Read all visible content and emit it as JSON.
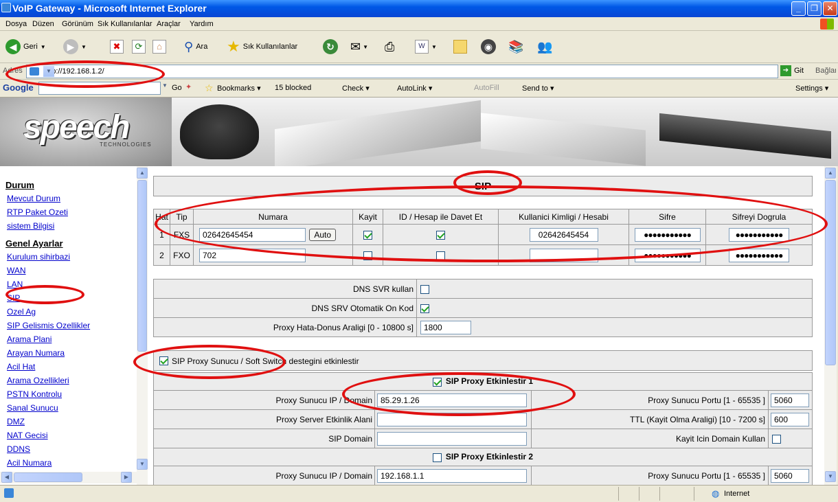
{
  "window": {
    "title": "VoIP Gateway - Microsoft Internet Explorer"
  },
  "menu": [
    "Dosya",
    "Düzen",
    "Görünüm",
    "Sık Kullanılanlar",
    "Araçlar",
    "Yardım"
  ],
  "toolbar": {
    "back": "Geri",
    "search": "Ara",
    "favorites": "Sık Kullanılanlar"
  },
  "address": {
    "label": "Adres",
    "url": "http://192.168.1.2/",
    "go": "Git",
    "links": "Bağlantılar"
  },
  "google": {
    "logo": "Google",
    "go": "Go",
    "bookmarks": "Bookmarks",
    "blocked": "15 blocked",
    "check": "Check",
    "autolink": "AutoLink",
    "autofill": "AutoFill",
    "send": "Send to",
    "settings": "Settings"
  },
  "banner": {
    "logo": "speech",
    "sub": "TECHNOLOGIES"
  },
  "sidebar": {
    "sections": [
      {
        "title": "Durum",
        "items": [
          "Mevcut Durum",
          "RTP Paket Ozeti",
          "sistem Bilgisi"
        ]
      },
      {
        "title": "Genel Ayarlar",
        "items": [
          "Kurulum sihirbazi",
          "WAN",
          "LAN",
          "SIP",
          "Ozel Ag",
          "SIP Gelismis Ozellikler",
          "Arama Plani",
          "Arayan Numara",
          "Acil Hat",
          "Arama Ozellikleri",
          "PSTN Kontrolu",
          "Sanal Sunucu",
          "DMZ",
          "NAT Gecisi",
          "DDNS",
          "Acil Numara"
        ]
      }
    ]
  },
  "sip": {
    "title": "SIP",
    "headers": [
      "Hat",
      "Tip",
      "Numara",
      "Kayit",
      "ID / Hesap ile Davet Et",
      "Kullanici Kimligi / Hesabi",
      "Sifre",
      "Sifreyi Dogrula"
    ],
    "rows": [
      {
        "hat": "1",
        "tip": "FXS",
        "numara": "02642645454",
        "auto": "Auto",
        "kayit": true,
        "davet": true,
        "kimlik": "02642645454",
        "sifre": "●●●●●●●●●●●",
        "dogrula": "●●●●●●●●●●●"
      },
      {
        "hat": "2",
        "tip": "FXO",
        "numara": "702",
        "kayit": false,
        "davet": false,
        "kimlik": "",
        "sifre": "●●●●●●●●●●●",
        "dogrula": "●●●●●●●●●●●"
      }
    ],
    "dns_svr": "DNS SVR kullan",
    "dns_srv_auto": "DNS SRV Otomatik On Kod",
    "proxy_retry": "Proxy Hata-Donus Araligi [0 - 10800 s]",
    "proxy_retry_value": "1800",
    "softswitch": "SIP Proxy Sunucu / Soft Switch destegini etkinlestir",
    "proxy1": {
      "title": "SIP Proxy Etkinlestir 1",
      "ip_label": "Proxy Sunucu IP / Domain",
      "ip_value": "85.29.1.26",
      "port_label": "Proxy Sunucu Portu [1 - 65535 ]",
      "port_value": "5060",
      "realm_label": "Proxy Server Etkinlik Alani",
      "ttl_label": "TTL (Kayit Olma Araligi) [10 - 7200 s]",
      "ttl_value": "600",
      "domain_label": "SIP Domain",
      "use_domain_label": "Kayit Icin Domain Kullan"
    },
    "proxy2": {
      "title": "SIP Proxy Etkinlestir 2",
      "ip_label": "Proxy Sunucu IP / Domain",
      "ip_value": "192.168.1.1",
      "port_label": "Proxy Sunucu Portu [1 - 65535 ]",
      "port_value": "5060"
    }
  },
  "status": {
    "zone": "Internet"
  }
}
